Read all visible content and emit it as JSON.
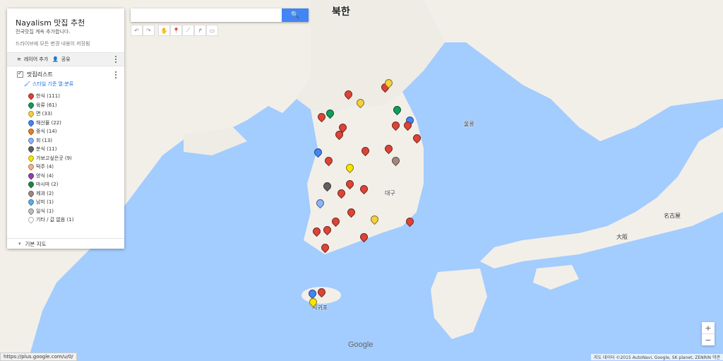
{
  "map": {
    "labels": {
      "north": "북한",
      "tokyo_area": "名古屋",
      "osaka": "大阪",
      "east_sea_label": "울릉",
      "jeju": "서귀포",
      "daegu": "대구"
    }
  },
  "panel": {
    "title": "Nayalism 맛집 추천",
    "description": "전국맛집 계속 추가합니다.",
    "saved_note": "드라이브에 모든 변경 내용이 저장됨",
    "add_layer": "레이어 추가",
    "share": "공유",
    "layer_name": "맛집리스트",
    "style_link": "스타일 기준 열:분류",
    "categories": [
      {
        "label": "한식 (111)",
        "color": "#db4437"
      },
      {
        "label": "육류 (61)",
        "color": "#0f9d58"
      },
      {
        "label": "면 (33)",
        "color": "#f4d03f"
      },
      {
        "label": "해산물 (22)",
        "color": "#4285f4"
      },
      {
        "label": "중식 (14)",
        "color": "#e67e22"
      },
      {
        "label": "회 (13)",
        "color": "#8ab4f8"
      },
      {
        "label": "분식 (11)",
        "color": "#616161"
      },
      {
        "label": "가보고싶은곳 (9)",
        "color": "#f7e600"
      },
      {
        "label": "떡주 (4)",
        "color": "#f4b183"
      },
      {
        "label": "양식 (4)",
        "color": "#8e44ad"
      },
      {
        "label": "마시마 (2)",
        "color": "#1e8449"
      },
      {
        "label": "제과 (2)",
        "color": "#a1887f"
      },
      {
        "label": "남미 (1)",
        "color": "#5dade2"
      },
      {
        "label": "일식 (1)",
        "color": "#bdbdbd"
      },
      {
        "label": "기타 / 값 없음 (1)",
        "color": "#ffffff"
      }
    ],
    "basemap": "기본 지도"
  },
  "search": {
    "placeholder": ""
  },
  "status_url": "https://plus.google.com/u/0/",
  "attribution": "지도 데이터 ©2015 AutoNavi, Google, SK planet, ZENRIN  약관",
  "google": "Google",
  "markers": [
    {
      "c": "#db4437"
    },
    {
      "c": "#db4437"
    },
    {
      "c": "#f4d03f"
    },
    {
      "c": "#0f9d58"
    },
    {
      "c": "#db4437"
    },
    {
      "c": "#4285f4"
    },
    {
      "c": "#db4437"
    },
    {
      "c": "#f4d03f"
    },
    {
      "c": "#db4437"
    },
    {
      "c": "#a1887f"
    },
    {
      "c": "#db4437"
    },
    {
      "c": "#db4437"
    },
    {
      "c": "#db4437"
    },
    {
      "c": "#4285f4"
    },
    {
      "c": "#db4437"
    },
    {
      "c": "#f7e600"
    },
    {
      "c": "#db4437"
    },
    {
      "c": "#616161"
    },
    {
      "c": "#db4437"
    },
    {
      "c": "#8ab4f8"
    },
    {
      "c": "#db4437"
    },
    {
      "c": "#db4437"
    },
    {
      "c": "#db4437"
    },
    {
      "c": "#db4437"
    },
    {
      "c": "#f4d03f"
    },
    {
      "c": "#db4437"
    },
    {
      "c": "#db4437"
    },
    {
      "c": "#db4437"
    },
    {
      "c": "#4285f4"
    },
    {
      "c": "#f7e600"
    },
    {
      "c": "#db4437"
    },
    {
      "c": "#db4437"
    },
    {
      "c": "#db4437"
    },
    {
      "c": "#0f9d58"
    },
    {
      "c": "#db4437"
    }
  ]
}
